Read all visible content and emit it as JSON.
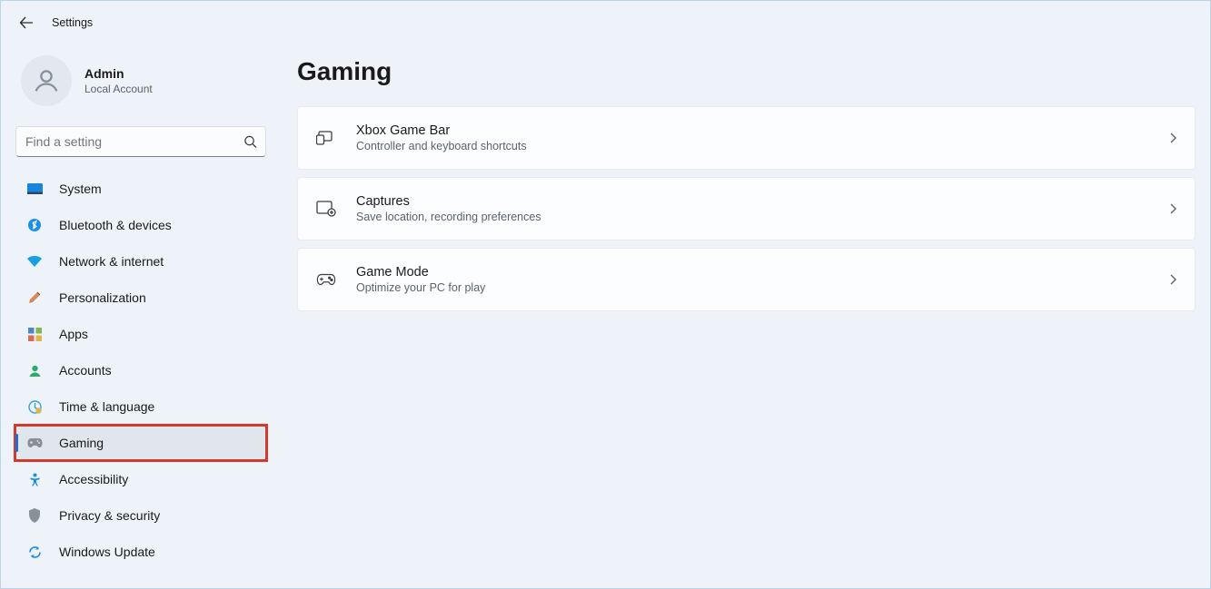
{
  "window": {
    "title": "Settings"
  },
  "user": {
    "name": "Admin",
    "subtitle": "Local Account"
  },
  "search": {
    "placeholder": "Find a setting"
  },
  "sidebar": {
    "items": [
      {
        "label": "System"
      },
      {
        "label": "Bluetooth & devices"
      },
      {
        "label": "Network & internet"
      },
      {
        "label": "Personalization"
      },
      {
        "label": "Apps"
      },
      {
        "label": "Accounts"
      },
      {
        "label": "Time & language"
      },
      {
        "label": "Gaming"
      },
      {
        "label": "Accessibility"
      },
      {
        "label": "Privacy & security"
      },
      {
        "label": "Windows Update"
      }
    ],
    "selected_index": 7,
    "highlighted_index": 7
  },
  "page": {
    "title": "Gaming"
  },
  "cards": [
    {
      "title": "Xbox Game Bar",
      "subtitle": "Controller and keyboard shortcuts"
    },
    {
      "title": "Captures",
      "subtitle": "Save location, recording preferences"
    },
    {
      "title": "Game Mode",
      "subtitle": "Optimize your PC for play"
    }
  ]
}
